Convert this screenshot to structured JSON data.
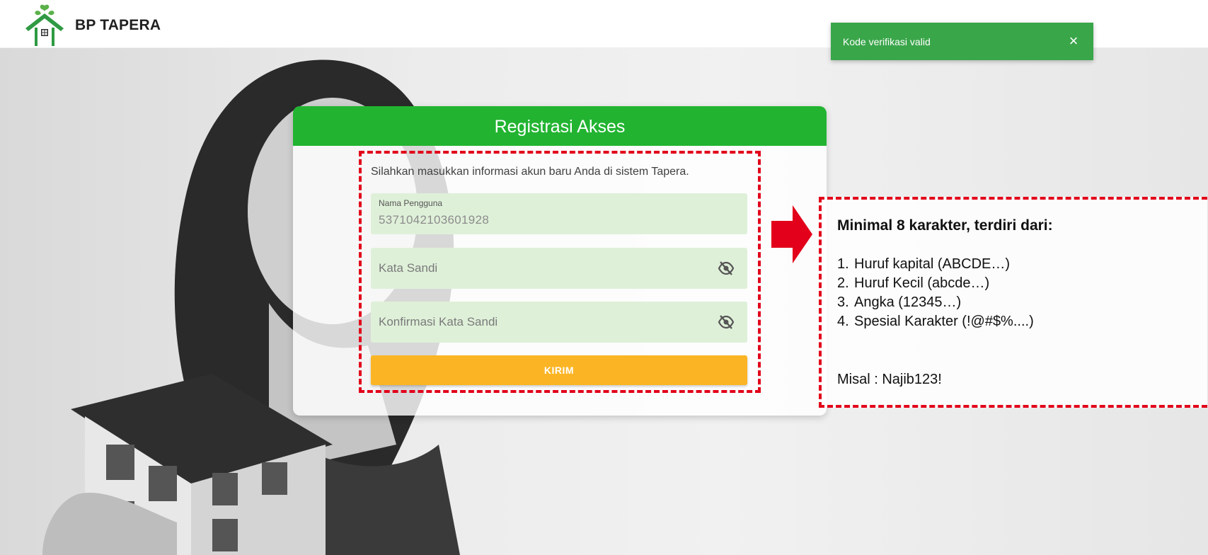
{
  "header": {
    "logo_icon": "house-with-leaves-icon",
    "brand": "BP TAPERA"
  },
  "toast": {
    "message": "Kode verifikasi valid",
    "close_icon": "close-icon",
    "close_label": "×",
    "color": "#3aa64a"
  },
  "form": {
    "title": "Registrasi Akses",
    "intro": "Silahkan masukkan informasi akun baru Anda di sistem Tapera.",
    "username": {
      "label": "Nama Pengguna",
      "value": "5371042103601928"
    },
    "password": {
      "placeholder": "Kata Sandi",
      "icon": "eye-off-icon"
    },
    "confirm_password": {
      "placeholder": "Konfirmasi Kata Sandi",
      "icon": "eye-off-icon"
    },
    "submit_label": "KIRIM",
    "header_color": "#22b431",
    "submit_color": "#fbb524"
  },
  "annotation": {
    "arrow_icon": "right-arrow-icon",
    "title": "Minimal 8 karakter, terdiri dari:",
    "items": [
      {
        "num": "1.",
        "text": "Huruf kapital (ABCDE…)"
      },
      {
        "num": "2.",
        "text": "Huruf Kecil (abcde…)"
      },
      {
        "num": "3.",
        "text": "Angka (12345…)"
      },
      {
        "num": "4.",
        "text": "Spesial Karakter (!@#$%....)"
      }
    ],
    "example": "Misal : Najib123!",
    "color": "#e2001a"
  }
}
